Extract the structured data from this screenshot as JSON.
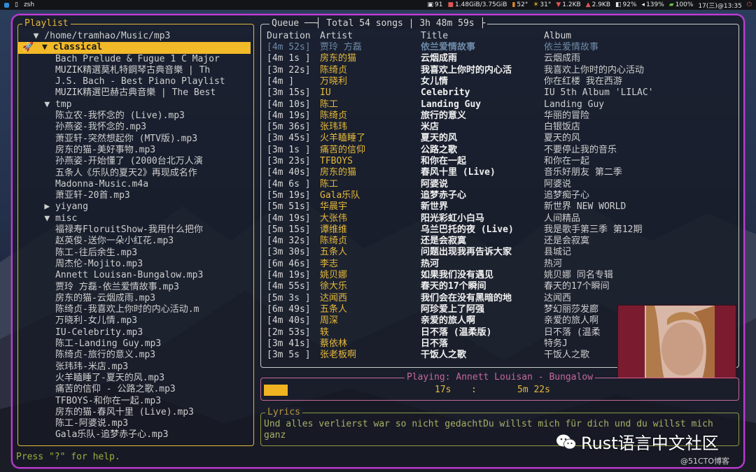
{
  "topbar": {
    "terminal_label": "zsh",
    "cpu": "91",
    "mem": "1.48GiB/3.75GiB",
    "temp": "52°",
    "temp2": "31°",
    "net_up": "1.2KB",
    "net_down": "2.9KB",
    "battery_low": "92%",
    "volume": "139%",
    "brightness": "100%",
    "clock": "17(三)@13:35"
  },
  "playlist": {
    "title": "Playlist",
    "rows": [
      {
        "indent": 1,
        "text": "▼ /home/tramhao/Music/mp3"
      },
      {
        "indent": 1,
        "text": "▼ classical",
        "selected": true
      },
      {
        "indent": 3,
        "text": "Bach Prelude & Fugue 1 C Major"
      },
      {
        "indent": 3,
        "text": "MUZIK精選莫札特鋼琴古典音樂 | Th"
      },
      {
        "indent": 3,
        "text": "J.S. Bach - Best Piano Playlist"
      },
      {
        "indent": 3,
        "text": "MUZIK精選巴赫古典音樂 | The Best"
      },
      {
        "indent": 2,
        "text": "▼ tmp"
      },
      {
        "indent": 3,
        "text": "陈立农-我怀念的 (Live).mp3"
      },
      {
        "indent": 3,
        "text": "孙燕姿-我怀念的.mp3"
      },
      {
        "indent": 3,
        "text": "萧亚轩-突然想起你 (MTV版).mp3"
      },
      {
        "indent": 3,
        "text": "房东的猫-美好事物.mp3"
      },
      {
        "indent": 3,
        "text": "孙燕姿-开始懂了 (2000台北万人演"
      },
      {
        "indent": 3,
        "text": "五条人《乐队的夏天2》再现成名作"
      },
      {
        "indent": 3,
        "text": "Madonna-Music.m4a"
      },
      {
        "indent": 3,
        "text": "萧亚轩-20首.mp3"
      },
      {
        "indent": 2,
        "text": "▶ yiyang"
      },
      {
        "indent": 2,
        "text": "▼ misc"
      },
      {
        "indent": 3,
        "text": "福禄寿FloruitShow-我用什么把你"
      },
      {
        "indent": 3,
        "text": "赵英俊-送你一朵小红花.mp3"
      },
      {
        "indent": 3,
        "text": "陈工-往后余生.mp3"
      },
      {
        "indent": 3,
        "text": "周杰伦-Mojito.mp3"
      },
      {
        "indent": 3,
        "text": "Annett Louisan-Bungalow.mp3"
      },
      {
        "indent": 3,
        "text": "贾玲 方磊-依兰爱情故事.mp3"
      },
      {
        "indent": 3,
        "text": "房东的猫-云烟成雨.mp3"
      },
      {
        "indent": 3,
        "text": "陈绮贞-我喜欢上你时的内心活动.m"
      },
      {
        "indent": 3,
        "text": "万晓利-女儿情.mp3"
      },
      {
        "indent": 3,
        "text": "IU-Celebrity.mp3"
      },
      {
        "indent": 3,
        "text": "陈工-Landing Guy.mp3"
      },
      {
        "indent": 3,
        "text": "陈绮贞-旅行的意义.mp3"
      },
      {
        "indent": 3,
        "text": "张玮玮-米店.mp3"
      },
      {
        "indent": 3,
        "text": "火羊瞌睡了-夏天的风.mp3"
      },
      {
        "indent": 3,
        "text": "痛苦的信仰 - 公路之歌.mp3"
      },
      {
        "indent": 3,
        "text": "TFBOYS-和你在一起.mp3"
      },
      {
        "indent": 3,
        "text": "房东的猫-春风十里 (Live).mp3"
      },
      {
        "indent": 3,
        "text": "陈工-阿婆说.mp3"
      },
      {
        "indent": 3,
        "text": "Gala乐队-追梦赤子心.mp3"
      }
    ]
  },
  "queue": {
    "title_prefix": "Queue",
    "title_total": "Total 54 songs",
    "title_time": "3h 48m 59s",
    "headers": {
      "duration": "Duration",
      "artist": "Artist",
      "title": "Title",
      "album": "Album"
    },
    "rows": [
      {
        "d": "[4m 52s]",
        "a": "贾玲 方磊",
        "t": "依兰爱情故事",
        "al": "依兰爱情故事"
      },
      {
        "d": "[4m 1s ]",
        "a": "房东的猫",
        "t": "云烟成雨",
        "al": "云烟成雨"
      },
      {
        "d": "[3m 22s]",
        "a": "陈绮贞",
        "t": "我喜欢上你时的内心活",
        "al": "我喜欢上你时的内心活动"
      },
      {
        "d": "[4m    ]",
        "a": "万晓利",
        "t": "女儿情",
        "al": "你在红楼 我在西游"
      },
      {
        "d": "[3m 15s]",
        "a": "IU",
        "t": "Celebrity",
        "al": "IU 5th Album 'LILAC'"
      },
      {
        "d": "[4m 10s]",
        "a": "陈工",
        "t": "Landing Guy",
        "al": "Landing Guy"
      },
      {
        "d": "[4m 19s]",
        "a": "陈绮贞",
        "t": "旅行的意义",
        "al": "华丽的冒险"
      },
      {
        "d": "[5m 36s]",
        "a": "张玮玮",
        "t": "米店",
        "al": "白银饭店"
      },
      {
        "d": "[3m 45s]",
        "a": "火羊瞌睡了",
        "t": "夏天的风",
        "al": "夏天的风"
      },
      {
        "d": "[3m 1s ]",
        "a": "痛苦的信仰",
        "t": "公路之歌",
        "al": "不要停止我的音乐"
      },
      {
        "d": "[3m 23s]",
        "a": "TFBOYS",
        "t": "和你在一起",
        "al": "和你在一起"
      },
      {
        "d": "[4m 40s]",
        "a": "房东的猫",
        "t": "春风十里 (Live)",
        "al": "音乐好朋友 第二季"
      },
      {
        "d": "[4m 6s ]",
        "a": "陈工",
        "t": "阿婆说",
        "al": "阿婆说"
      },
      {
        "d": "[5m 19s]",
        "a": "Gala乐队",
        "t": "追梦赤子心",
        "al": "追梦痴子心"
      },
      {
        "d": "[5m 51s]",
        "a": "华晨宇",
        "t": "新世界",
        "al": "新世界 NEW WORLD"
      },
      {
        "d": "[4m 19s]",
        "a": "大张伟",
        "t": "阳光彩虹小白马",
        "al": "人间精品"
      },
      {
        "d": "[5m 15s]",
        "a": "谭维维",
        "t": "乌兰巴托的夜 (Live)",
        "al": "我是歌手第三季 第12期"
      },
      {
        "d": "[4m 32s]",
        "a": "陈绮贞",
        "t": "还是会寂寞",
        "al": "还是会寂寞"
      },
      {
        "d": "[3m 30s]",
        "a": "五条人",
        "t": "问题出现我再告诉大家",
        "al": "县城记"
      },
      {
        "d": "[6m 46s]",
        "a": "李志",
        "t": "热河",
        "al": "热河"
      },
      {
        "d": "[4m 19s]",
        "a": "姚贝娜",
        "t": "如果我们没有遇见",
        "al": "姚贝娜 同名专辑"
      },
      {
        "d": "[4m 55s]",
        "a": "徐大乐",
        "t": "春天的17个瞬间",
        "al": "春天的17个瞬间"
      },
      {
        "d": "[5m 3s ]",
        "a": "达闻西",
        "t": "我们会在没有黑暗的地",
        "al": "达闻西"
      },
      {
        "d": "[6m 49s]",
        "a": "五条人",
        "t": "阿珍爱上了阿强",
        "al": "梦幻丽莎发廊"
      },
      {
        "d": "[4m 40s]",
        "a": "周深",
        "t": "亲爱的旅人啊",
        "al": "亲爱的旅人啊"
      },
      {
        "d": "[2m 53s]",
        "a": "轶",
        "t": "日不落 (温柔版)",
        "al": "日不落 (温柔"
      },
      {
        "d": "[3m 41s]",
        "a": "蔡依林",
        "t": "日不落",
        "al": "特务J"
      },
      {
        "d": "[3m 5s ]",
        "a": "张老板啊",
        "t": "干饭人之歌",
        "al": "干饭人之歌"
      }
    ]
  },
  "playing": {
    "title": "Playing: Annett Louisan - Bungalow",
    "elapsed": "17s",
    "total": "5m 22s",
    "progress": 0.05
  },
  "lyrics": {
    "title": "Lyrics",
    "text": "Und alles verlierst war so nicht gedachtDu willst mich für dich und du willst mich ganz"
  },
  "help": "Press \"?\" for help.",
  "watermark": {
    "brand": "Rust语言中文社区",
    "sub": "@51CTO博客"
  },
  "colors": {
    "accent": "#c23ad8",
    "highlight": "#f2b928",
    "artist": "#e5b93a"
  }
}
